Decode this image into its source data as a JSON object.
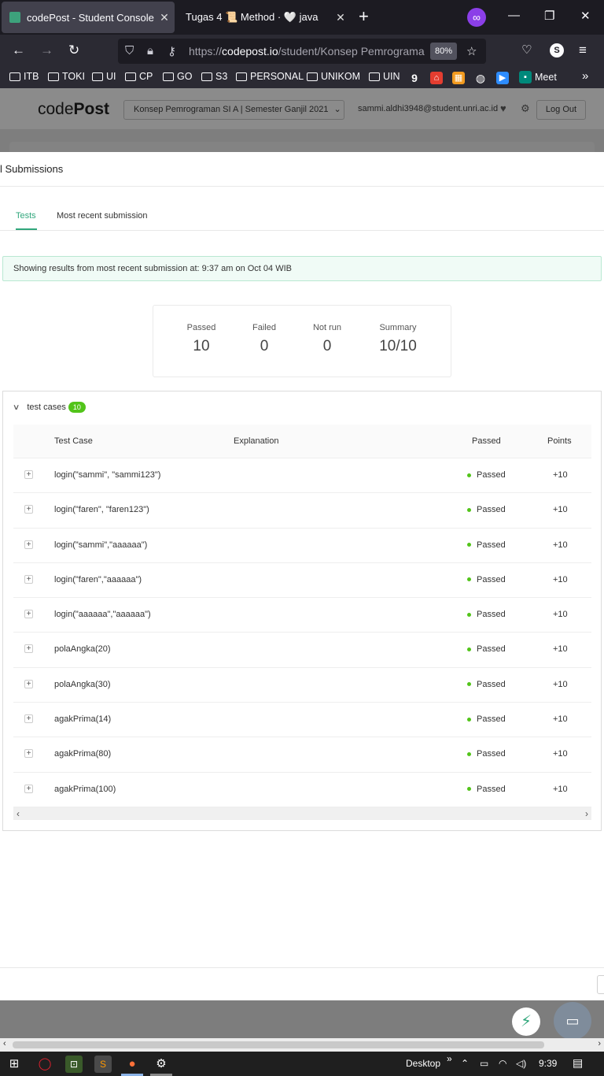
{
  "browser": {
    "tabs": [
      {
        "title": "codePost - Student Console",
        "active": true
      },
      {
        "title": "Tugas 4 📜 Method · 🤍 java",
        "active": false
      }
    ],
    "url_prefix": "https://",
    "url_host": "codepost.io",
    "url_path": "/student/Konsep Pemrograma",
    "zoom": "80%",
    "profile_initial": "S",
    "bookmarks": [
      "ITB",
      "TOKI",
      "UI",
      "CP",
      "GO",
      "S3",
      "PERSONAL",
      "UNIKOM",
      "UIN"
    ],
    "bookmark_meet": "Meet"
  },
  "header": {
    "logo_plain": "code",
    "logo_bold": "Post",
    "course": "Konsep Pemrograman SI A | Semester Ganjil 2021",
    "email": "sammi.aldhi3948@student.unri.ac.id",
    "logout": "Log Out"
  },
  "modal": {
    "title": "l Submissions",
    "tabs": [
      "Tests",
      "Most recent submission"
    ],
    "alert": "Showing results from most recent submission at: 9:37 am on Oct 04 WIB",
    "stats": [
      {
        "label": "Passed",
        "value": "10"
      },
      {
        "label": "Failed",
        "value": "0"
      },
      {
        "label": "Not run",
        "value": "0"
      },
      {
        "label": "Summary",
        "value": "10/10"
      }
    ],
    "cases_title": "test cases",
    "cases_count": "10",
    "columns": {
      "case": "Test Case",
      "explanation": "Explanation",
      "passed": "Passed",
      "points": "Points"
    },
    "rows": [
      {
        "case": "login(\"sammi\", \"sammi123\")",
        "status": "Passed",
        "points": "+10"
      },
      {
        "case": "login(\"faren\", \"faren123\")",
        "status": "Passed",
        "points": "+10"
      },
      {
        "case": "login(\"sammi\",\"aaaaaa\")",
        "status": "Passed",
        "points": "+10"
      },
      {
        "case": "login(\"faren\",\"aaaaaa\")",
        "status": "Passed",
        "points": "+10"
      },
      {
        "case": "login(\"aaaaaa\",\"aaaaaa\")",
        "status": "Passed",
        "points": "+10"
      },
      {
        "case": "polaAngka(20)",
        "status": "Passed",
        "points": "+10"
      },
      {
        "case": "polaAngka(30)",
        "status": "Passed",
        "points": "+10"
      },
      {
        "case": "agakPrima(14)",
        "status": "Passed",
        "points": "+10"
      },
      {
        "case": "agakPrima(80)",
        "status": "Passed",
        "points": "+10"
      },
      {
        "case": "agakPrima(100)",
        "status": "Passed",
        "points": "+10"
      }
    ]
  },
  "taskbar": {
    "desktop_label": "Desktop",
    "time": "9:39"
  },
  "colors": {
    "accent": "#31a77c",
    "passed_dot": "#52c41a",
    "browser_dark": "#1c1b22"
  }
}
